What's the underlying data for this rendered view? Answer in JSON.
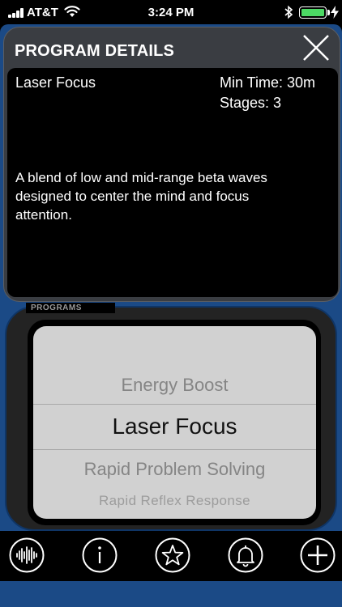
{
  "status_bar": {
    "carrier": "AT&T",
    "time": "3:24 PM",
    "battery_color": "#4cd964"
  },
  "section": {
    "label": "PROGRAMS"
  },
  "modal": {
    "title": "PROGRAM DETAILS",
    "program_name": "Laser Focus",
    "min_time": "Min Time: 30m",
    "stages": "Stages: 3",
    "description": "A blend of low and mid-range beta waves designed to center the mind and focus attention."
  },
  "picker": {
    "items": [
      "Energy Boost",
      "Laser Focus",
      "Rapid Problem Solving",
      "Rapid Reflex Response"
    ],
    "selected": "Laser Focus"
  },
  "toolbar": {
    "icons": [
      "waveform-icon",
      "info-icon",
      "star-icon",
      "bell-icon",
      "plus-icon"
    ]
  },
  "colors": {
    "frame_blue": "#1b4a86",
    "modal_gray": "#3a3d42",
    "picker_gray": "#d1d1d1"
  }
}
